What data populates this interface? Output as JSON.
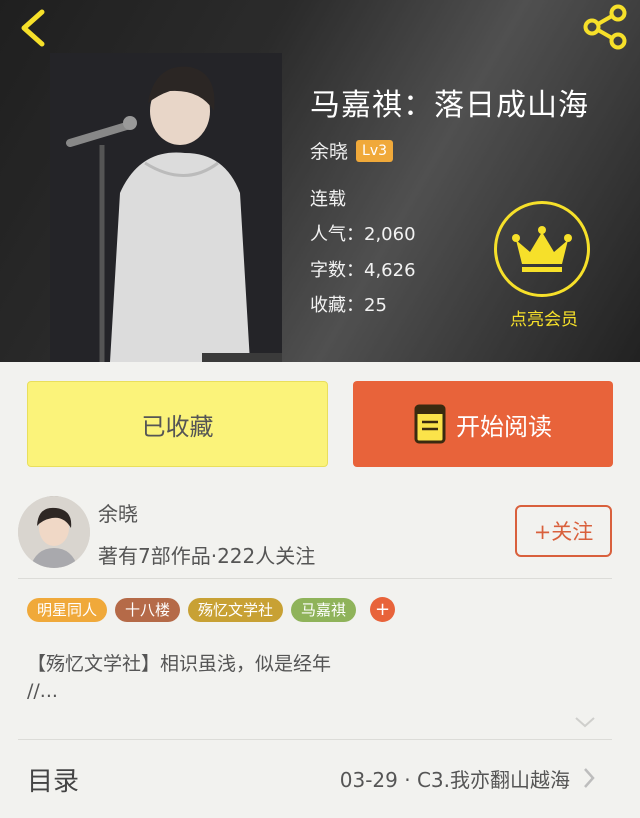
{
  "book": {
    "title": "马嘉祺：落日成山海",
    "author": "余晓",
    "level": "Lv3",
    "status": "连载",
    "popularity": "人气：2,060",
    "word_count": "字数：4,626",
    "favorites": "收藏：25"
  },
  "vip": {
    "label": "点亮会员"
  },
  "actions": {
    "collect_label": "已收藏",
    "read_label": "开始阅读"
  },
  "author_card": {
    "name": "余晓",
    "stats": "著有7部作品·222人关注",
    "follow_label": "+关注"
  },
  "tags": [
    {
      "label": "明星同人",
      "color": "#f0a93a"
    },
    {
      "label": "十八楼",
      "color": "#b56a48"
    },
    {
      "label": "殇忆文学社",
      "color": "#c8a134"
    },
    {
      "label": "马嘉祺",
      "color": "#8fb35a"
    }
  ],
  "tag_add_label": "+",
  "description": {
    "line1": "【殇忆文学社】相识虽浅，似是经年",
    "line2": "//..."
  },
  "toc": {
    "title": "目录",
    "latest": "03-29 · C3.我亦翻山越海"
  },
  "icons": {
    "back": "chevron-left-icon",
    "share": "share-icon",
    "crown": "crown-icon",
    "book": "book-icon",
    "expand": "chevron-down-icon",
    "toc_arrow": "chevron-right-icon"
  },
  "colors": {
    "accent_orange": "#e8633a",
    "collect_yellow": "#fbf37a",
    "vip_yellow": "#f6e02a",
    "level_badge": "#f0a93a"
  }
}
